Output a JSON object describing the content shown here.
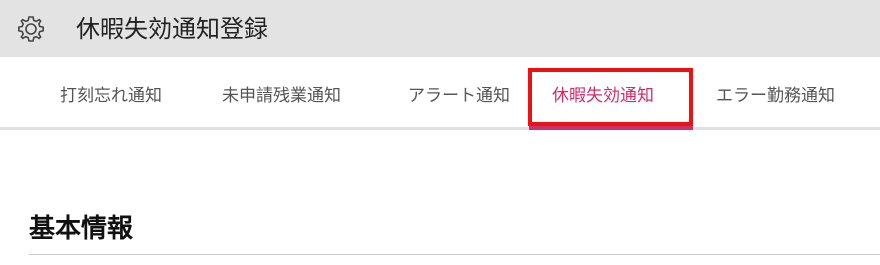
{
  "header": {
    "icon": "gear-icon",
    "title": "休暇失効通知登録"
  },
  "tabs": [
    {
      "label": "打刻忘れ通知",
      "active": false
    },
    {
      "label": "未申請残業通知",
      "active": false
    },
    {
      "label": "アラート通知",
      "active": false
    },
    {
      "label": "休暇失効通知",
      "active": true
    },
    {
      "label": "エラー勤務通知",
      "active": false
    }
  ],
  "section": {
    "title": "基本情報"
  },
  "colors": {
    "header_bg": "#e3e3e3",
    "active_tab": "#d42a6a",
    "highlight_box": "#ee1111"
  }
}
